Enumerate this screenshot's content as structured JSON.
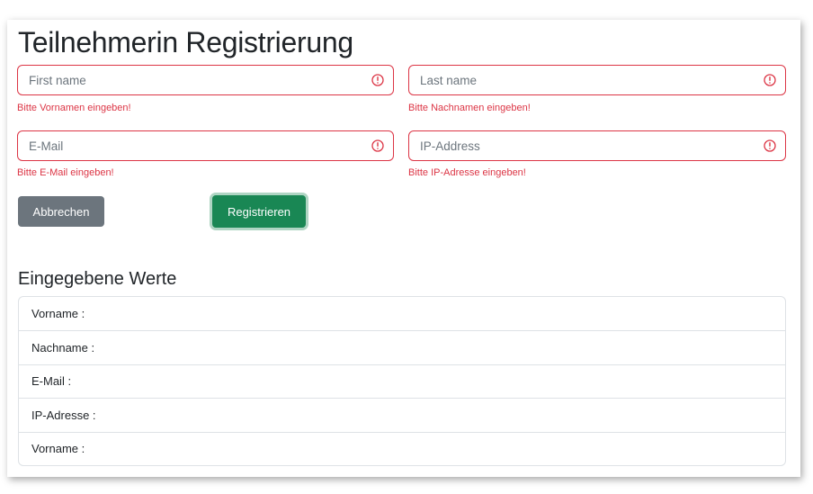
{
  "page": {
    "title": "Teilnehmerin Registrierung"
  },
  "form": {
    "first_name": {
      "value": "",
      "placeholder": "First name",
      "error": "Bitte Vornamen eingeben!"
    },
    "last_name": {
      "value": "",
      "placeholder": "Last name",
      "error": "Bitte Nachnamen eingeben!"
    },
    "email": {
      "value": "",
      "placeholder": "E-Mail",
      "error": "Bitte E-Mail eingeben!"
    },
    "ip": {
      "value": "",
      "placeholder": "IP-Address",
      "error": "Bitte IP-Adresse eingeben!"
    },
    "cancel_label": "Abbrechen",
    "submit_label": "Registrieren"
  },
  "results": {
    "title": "Eingegebene Werte",
    "items": [
      {
        "label": "Vorname :"
      },
      {
        "label": "Nachname :"
      },
      {
        "label": "E-Mail :"
      },
      {
        "label": "IP-Adresse :"
      },
      {
        "label": "Vorname :"
      }
    ]
  },
  "colors": {
    "danger": "#dc3545",
    "secondary": "#6c757d",
    "success": "#198754"
  },
  "icons": {
    "invalid": "exclamation-circle-icon"
  }
}
